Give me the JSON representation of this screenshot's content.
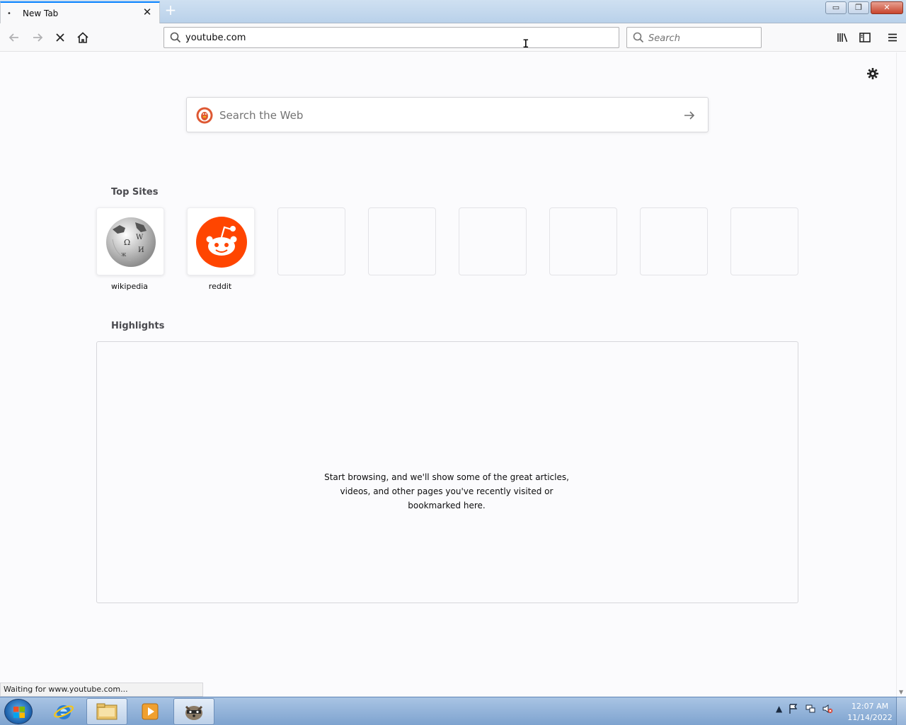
{
  "tab": {
    "title": "New Tab",
    "dot": "•",
    "close": "✕"
  },
  "newtab": "+",
  "window": {
    "minimize": "▭",
    "restore": "❐",
    "close": "✕"
  },
  "navbar": {
    "url": "youtube.com",
    "search_placeholder": "Search"
  },
  "page": {
    "websearch_placeholder": "Search the Web",
    "top_sites_title": "Top Sites",
    "top_sites": [
      {
        "label": "wikipedia"
      },
      {
        "label": "reddit"
      }
    ],
    "highlights_title": "Highlights",
    "highlights_message": "Start browsing, and we'll show some of the great articles, videos, and other pages you've recently visited or bookmarked here."
  },
  "status": "Waiting for www.youtube.com...",
  "taskbar": {
    "time": "12:07 AM",
    "date": "11/14/2022",
    "tray_arrow": "▲"
  },
  "colors": {
    "accent": "#0a84ff",
    "reddit": "#ff4500",
    "ddg": "#de5833"
  }
}
